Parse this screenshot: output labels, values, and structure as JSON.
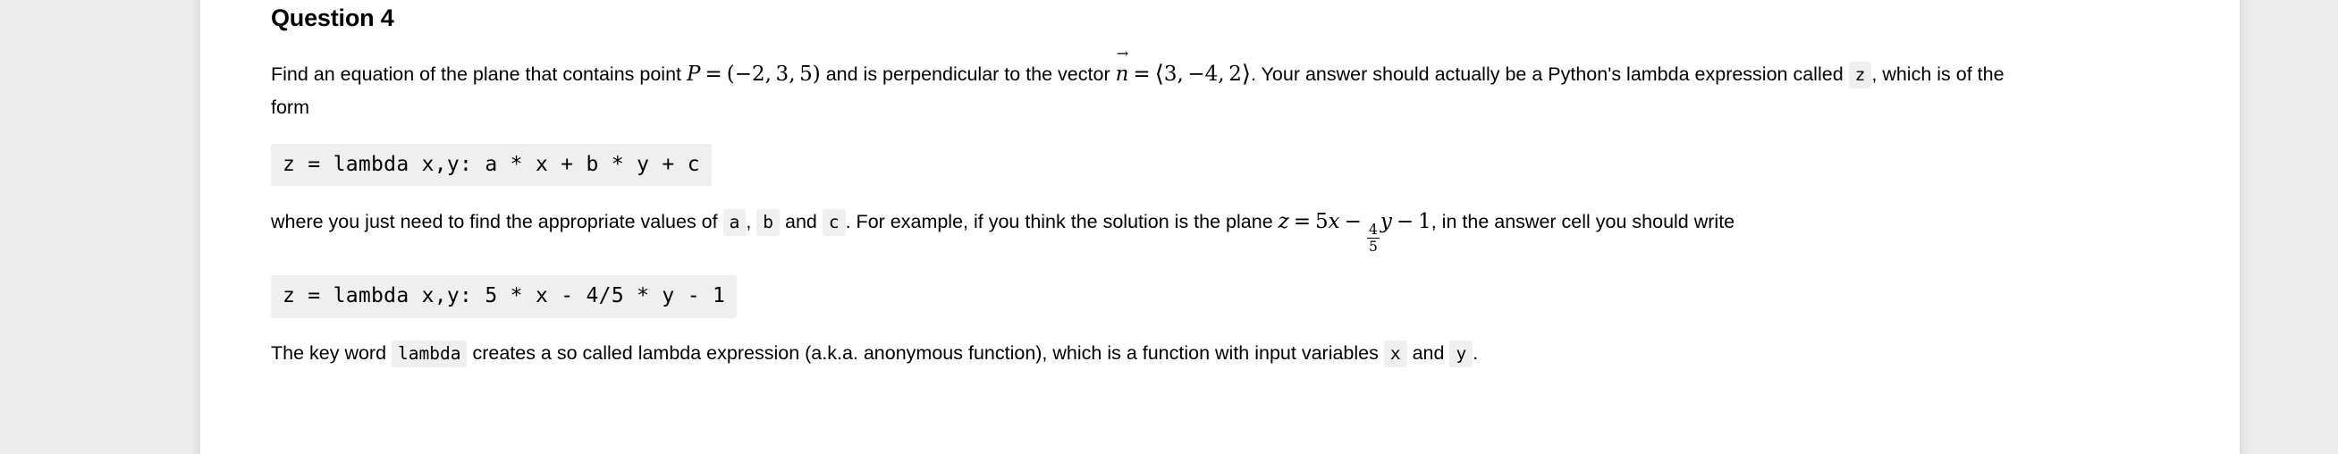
{
  "question": {
    "heading": "Question 4"
  },
  "paragraph1": {
    "seg1": "Find an equation of the plane that contains point ",
    "math_point": {
      "var": "P",
      "eq": "=",
      "open": "(",
      "x": "−2",
      "comma1": ",",
      "y": "3",
      "comma2": ",",
      "z": "5",
      "close": ")"
    },
    "seg2": " and is perpendicular to the vector ",
    "math_normal": {
      "var": "n",
      "arrow": "→",
      "eq": "=",
      "open": "⟨",
      "x": "3",
      "comma1": ",",
      "y": "−4",
      "comma2": ",",
      "z": "2",
      "close": "⟩"
    },
    "seg3": ". Your answer should actually be a Python's lambda expression called ",
    "chip_z": "z",
    "seg4": ", which is of the form"
  },
  "code_block_1": "z = lambda x,y: a * x + b * y + c",
  "paragraph2": {
    "seg1": "where you just need to find the appropriate values of ",
    "chip_a": "a",
    "seg2": ", ",
    "chip_b": "b",
    "seg3": " and ",
    "chip_c": "c",
    "seg4": ". For example, if you think the solution is the plane ",
    "math_plane": {
      "z": "z",
      "eq": "=",
      "five": "5",
      "x": "x",
      "minus1": "−",
      "frac_num": "4",
      "frac_den": "5",
      "y": "y",
      "minus2": "−",
      "one": "1"
    },
    "seg5": ", in the answer cell you should write"
  },
  "code_block_2": "z = lambda x,y: 5 * x - 4/5 * y - 1",
  "paragraph3": {
    "seg1": "The key word ",
    "chip_lambda": "lambda",
    "seg2": " creates a so called lambda expression (a.k.a. anonymous function), which is a function with input variables ",
    "chip_x": "x",
    "seg3": " and ",
    "chip_y": "y",
    "seg4": "."
  },
  "colors": {
    "page_background": "#ececec",
    "card_background": "#ffffff",
    "code_background": "#efefef",
    "text": "#000000"
  }
}
